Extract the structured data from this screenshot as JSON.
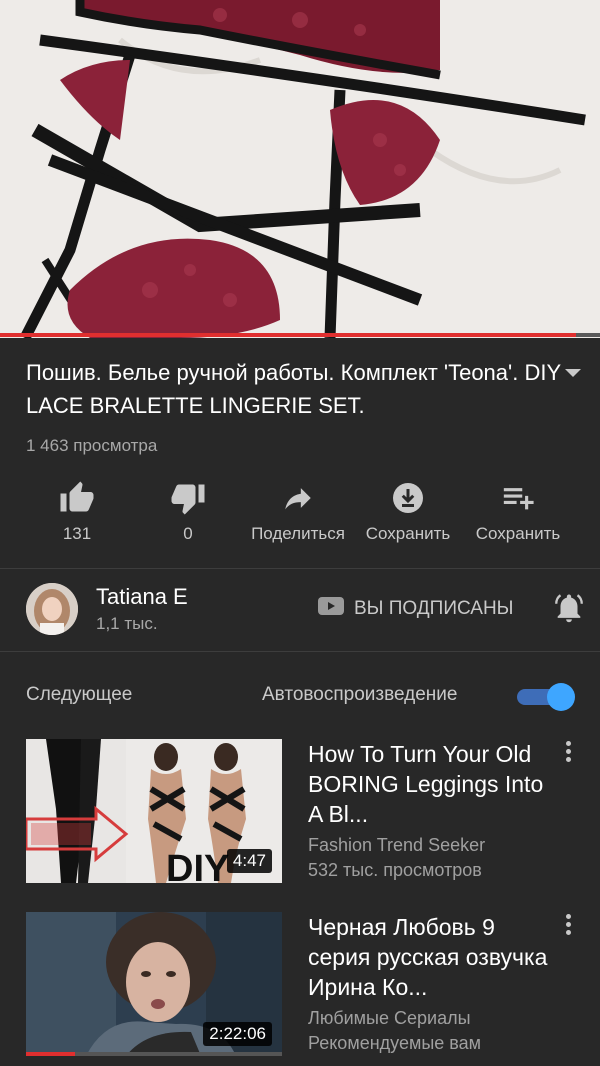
{
  "player": {
    "progress_percent": 96
  },
  "video": {
    "title": "Пошив. Белье ручной работы. Комплект 'Teona'. DIY LACE BRALETTE LINGERIE SET.",
    "views": "1 463 просмотра"
  },
  "actions": [
    {
      "icon": "thumbs-up-icon",
      "label": "131"
    },
    {
      "icon": "thumbs-down-icon",
      "label": "0"
    },
    {
      "icon": "share-icon",
      "label": "Поделиться"
    },
    {
      "icon": "download-icon",
      "label": "Сохранить"
    },
    {
      "icon": "add-to-playlist-icon",
      "label": "Сохранить"
    }
  ],
  "channel": {
    "name": "Tatiana E",
    "subscribers": "1,1 тыс.",
    "subscribed_label": "ВЫ ПОДПИСАНЫ"
  },
  "up_next": {
    "label": "Следующее",
    "autoplay_label": "Автовоспроизведение",
    "autoplay_on": true
  },
  "videos": [
    {
      "title": "How To Turn Your Old BORING Leggings Into A Bl...",
      "channel": "Fashion Trend Seeker",
      "meta": "532 тыс. просмотров",
      "duration": "4:47",
      "thumb_text": "DIY"
    },
    {
      "title": "Черная Любовь 9 серия русская озвучка Ирина Ко...",
      "channel": "Любимые Сериалы",
      "meta": "Рекомендуемые вам",
      "duration": "2:22:06",
      "watched_percent": 19
    }
  ],
  "colors": {
    "accent": "#3ea6ff",
    "progress": "#e02f2f",
    "background": "#282828"
  }
}
